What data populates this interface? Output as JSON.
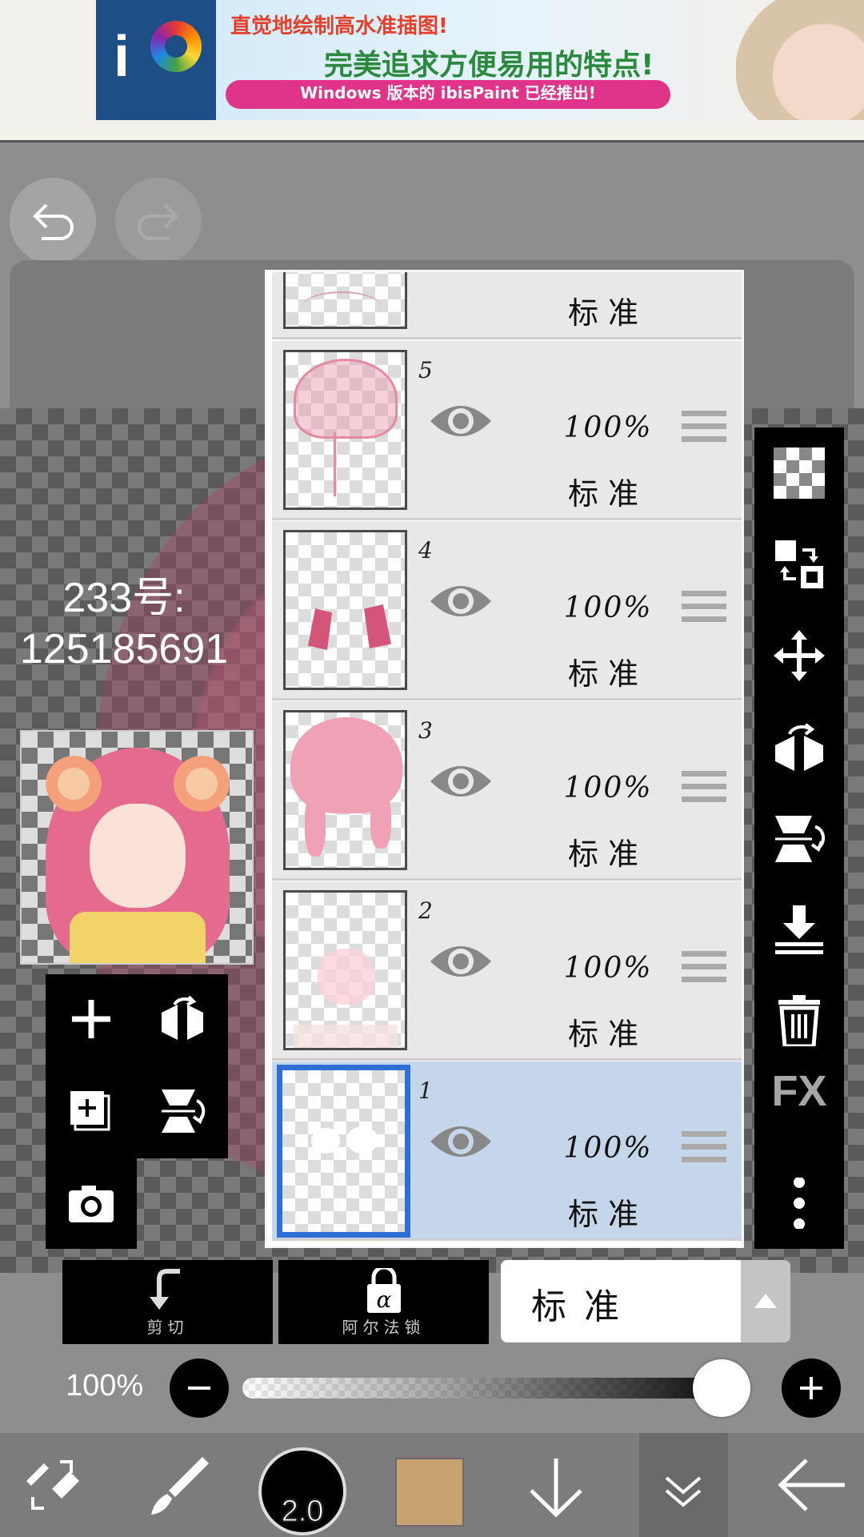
{
  "ad": {
    "line1": "直觉地绘制高水准插图!",
    "line2": "完美追求方便易用的特点!",
    "line3": "Windows 版本的 ibisPaint 已经推出!"
  },
  "canvas": {
    "watermark_line1": "233号:",
    "watermark_line2": "125185691"
  },
  "layers": [
    {
      "number": "",
      "opacity": "",
      "blend": "标准",
      "visible": true,
      "selected": false
    },
    {
      "number": "5",
      "opacity": "100%",
      "blend": "标准",
      "visible": true,
      "selected": false
    },
    {
      "number": "4",
      "opacity": "100%",
      "blend": "标准",
      "visible": true,
      "selected": false
    },
    {
      "number": "3",
      "opacity": "100%",
      "blend": "标准",
      "visible": true,
      "selected": false
    },
    {
      "number": "2",
      "opacity": "100%",
      "blend": "标准",
      "visible": true,
      "selected": false
    },
    {
      "number": "1",
      "opacity": "100%",
      "blend": "标准",
      "visible": true,
      "selected": true
    }
  ],
  "layer_controls": {
    "clip_label": "剪切",
    "alpha_lock_label": "阿尔法锁",
    "blend_mode": "标准"
  },
  "opacity": {
    "label": "100%",
    "fraction": 1.0
  },
  "bottom_toolbar": {
    "brush_size": "2.0",
    "current_color": "#c9a271"
  },
  "icons": {
    "right_toolbar": [
      "checker-icon",
      "layer-swap-icon",
      "move-icon",
      "flip-horizontal-icon",
      "flip-vertical-icon",
      "merge-down-icon",
      "trash-icon",
      "fx-icon",
      "more-icon"
    ],
    "left_tools": [
      "add-layer-icon",
      "flip-layer-horizontal-icon",
      "duplicate-layer-icon",
      "flip-layer-vertical-icon",
      "camera-icon"
    ],
    "bottom": [
      "transform-tool-icon",
      "brush-icon",
      "arrow-down-icon",
      "chevron-double-down-icon",
      "back-arrow-icon"
    ]
  },
  "fx_label": "FX"
}
